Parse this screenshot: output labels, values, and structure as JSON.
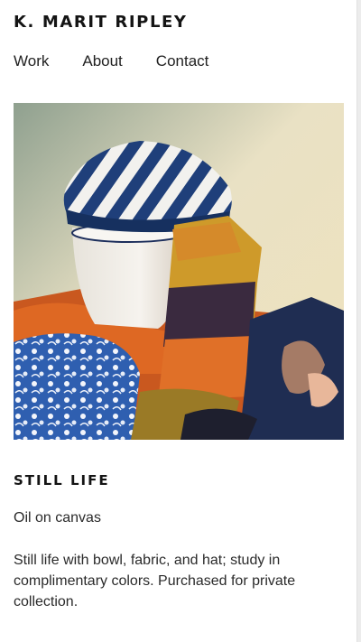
{
  "site": {
    "title": "K. MARIT RIPLEY"
  },
  "nav": {
    "items": [
      {
        "label": "Work"
      },
      {
        "label": "About"
      },
      {
        "label": "Contact"
      }
    ]
  },
  "artwork": {
    "title": "STILL LIFE",
    "medium": "Oil on canvas",
    "description": "Still life with bowl, fabric, and hat; study in complimentary colors. Purchased for private collection."
  }
}
